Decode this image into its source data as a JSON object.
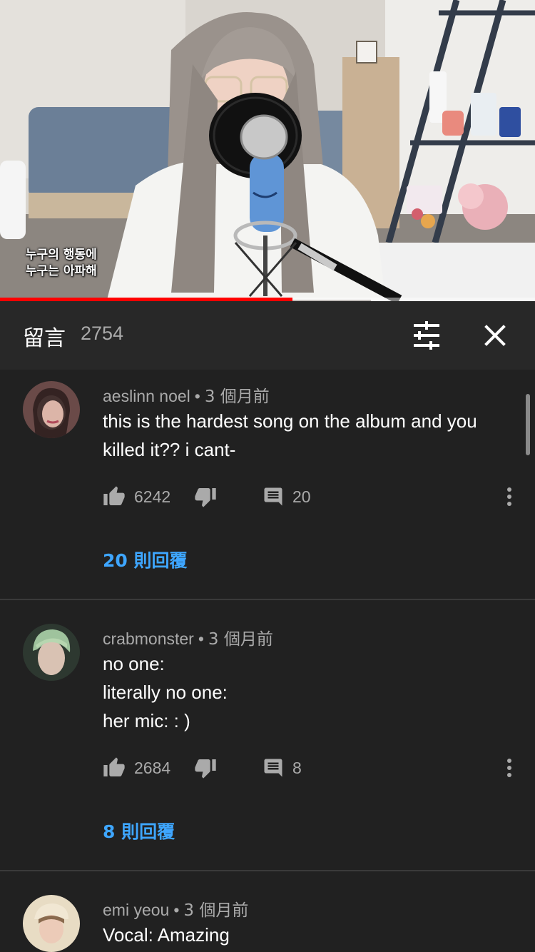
{
  "video": {
    "subtitle_line1": "누구의 행동에",
    "subtitle_line2": "누구는 아파해",
    "progress_fraction": 0.547
  },
  "comments_panel": {
    "title": "留言",
    "count": "2754",
    "sort_icon": "tune-icon",
    "close_icon": "close-icon"
  },
  "comments": [
    {
      "author": "aeslinn noel",
      "time": "3 個月前",
      "lines": [
        "this is the hardest song on the album and you",
        "killed it?? i cant-"
      ],
      "likes": "6242",
      "replies_count": "20",
      "replies_label": "20 則回覆",
      "avatar_color": "#6a4a48"
    },
    {
      "author": "crabmonster",
      "time": "3 個月前",
      "lines": [
        "no one:",
        "literally no one:",
        "her mic: : )"
      ],
      "likes": "2684",
      "replies_count": "8",
      "replies_label": "8 則回覆",
      "avatar_color": "#2d3830"
    },
    {
      "author": "emi yeou",
      "time": "3 個月前",
      "lines": [
        "Vocal: Amazing"
      ],
      "avatar_color": "#e8dcc4"
    }
  ],
  "colors": {
    "accent_link": "#3ea6ff",
    "progress": "#ff0000",
    "background": "#212121",
    "header_background": "#282828",
    "secondary_text": "#aaaaaa"
  }
}
